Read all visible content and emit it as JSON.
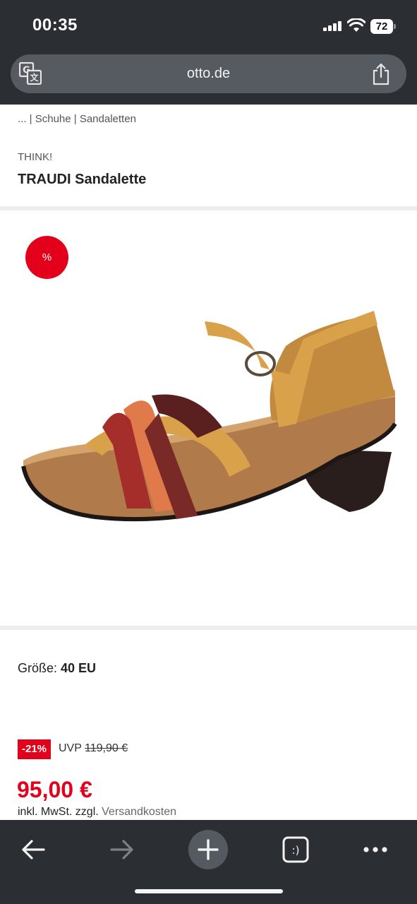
{
  "status_bar": {
    "time": "00:35",
    "battery": "72"
  },
  "browser": {
    "url": "otto.de"
  },
  "page": {
    "breadcrumb": "... | Schuhe | Sandaletten",
    "brand": "THINK!",
    "title": "TRAUDI Sandalette",
    "sale_badge": "%",
    "size_label": "Größe:",
    "size_value": "40 EU",
    "discount": "-21%",
    "uvp_label": "UVP",
    "uvp_price": "119,90 €",
    "price": "95,00 €",
    "vat_text": "inkl. MwSt. zzgl.",
    "shipping_link": "Versandkosten"
  },
  "toolbar": {
    "icons": [
      "back-arrow-icon",
      "forward-arrow-icon",
      "plus-icon",
      "tabs-icon",
      "more-icon"
    ]
  },
  "colors": {
    "chrome": "#2b2e33",
    "accent_red": "#e3001b"
  }
}
